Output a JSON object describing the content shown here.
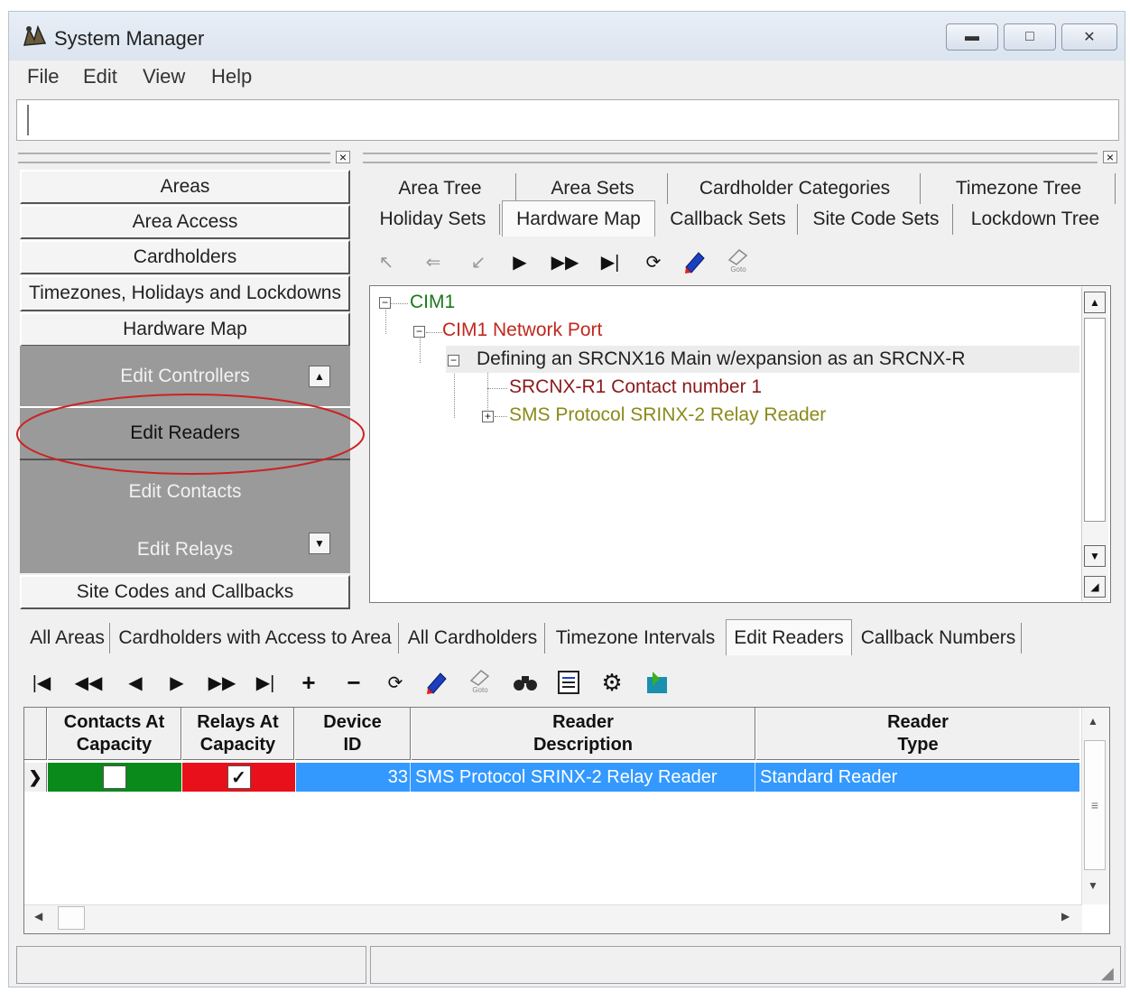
{
  "window": {
    "title": "System Manager"
  },
  "menu": [
    "File",
    "Edit",
    "View",
    "Help"
  ],
  "left_nav": {
    "items": [
      "Areas",
      "Area Access",
      "Cardholders",
      "Timezones, Holidays and Lockdowns",
      "Hardware Map"
    ],
    "sub_items": [
      "Edit Controllers",
      "Edit Readers",
      "Edit Contacts",
      "Edit Relays"
    ],
    "last_item": "Site Codes and Callbacks"
  },
  "top_tabs": {
    "row1": [
      "Area Tree",
      "Area Sets",
      "Cardholder Categories",
      "Timezone Tree"
    ],
    "row2": [
      "Holiday Sets",
      "Hardware Map",
      "Callback Sets",
      "Site Code Sets",
      "Lockdown Tree"
    ],
    "selected": "Hardware Map"
  },
  "tree": {
    "nodes": [
      {
        "label": "CIM1",
        "color": "#1a7a1a"
      },
      {
        "label": "CIM1 Network Port",
        "color": "#c0281e"
      },
      {
        "label": "Defining an SRCNX16 Main w/expansion as an SRCNX-R",
        "color": "#222222"
      },
      {
        "label": "SRCNX-R1 Contact number 1",
        "color": "#8b1a1a"
      },
      {
        "label": "SMS Protocol SRINX-2 Relay Reader",
        "color": "#8a8a1a"
      }
    ]
  },
  "goto_label": "Goto",
  "bottom_tabs": {
    "items": [
      "All Areas",
      "Cardholders with Access to Area",
      "All Cardholders",
      "Timezone Intervals",
      "Edit Readers",
      "Callback Numbers"
    ],
    "selected": "Edit Readers"
  },
  "grid": {
    "columns": [
      {
        "line1": "Contacts At",
        "line2": "Capacity"
      },
      {
        "line1": "Relays At",
        "line2": "Capacity"
      },
      {
        "line1": "Device",
        "line2": "ID"
      },
      {
        "line1": "Reader",
        "line2": "Description"
      },
      {
        "line1": "Reader",
        "line2": "Type"
      }
    ],
    "rows": [
      {
        "contacts_at_capacity": false,
        "relays_at_capacity": true,
        "device_id": "33",
        "reader_description": "SMS Protocol SRINX-2 Relay Reader",
        "reader_type": "Standard Reader"
      }
    ]
  },
  "colors": {
    "row_selected": "#3399ff",
    "contacts_cell": "#0a8a1a",
    "relays_cell": "#e8101a",
    "nav_gray": "#9a9a9a",
    "highlight_ellipse": "#cc2222"
  }
}
